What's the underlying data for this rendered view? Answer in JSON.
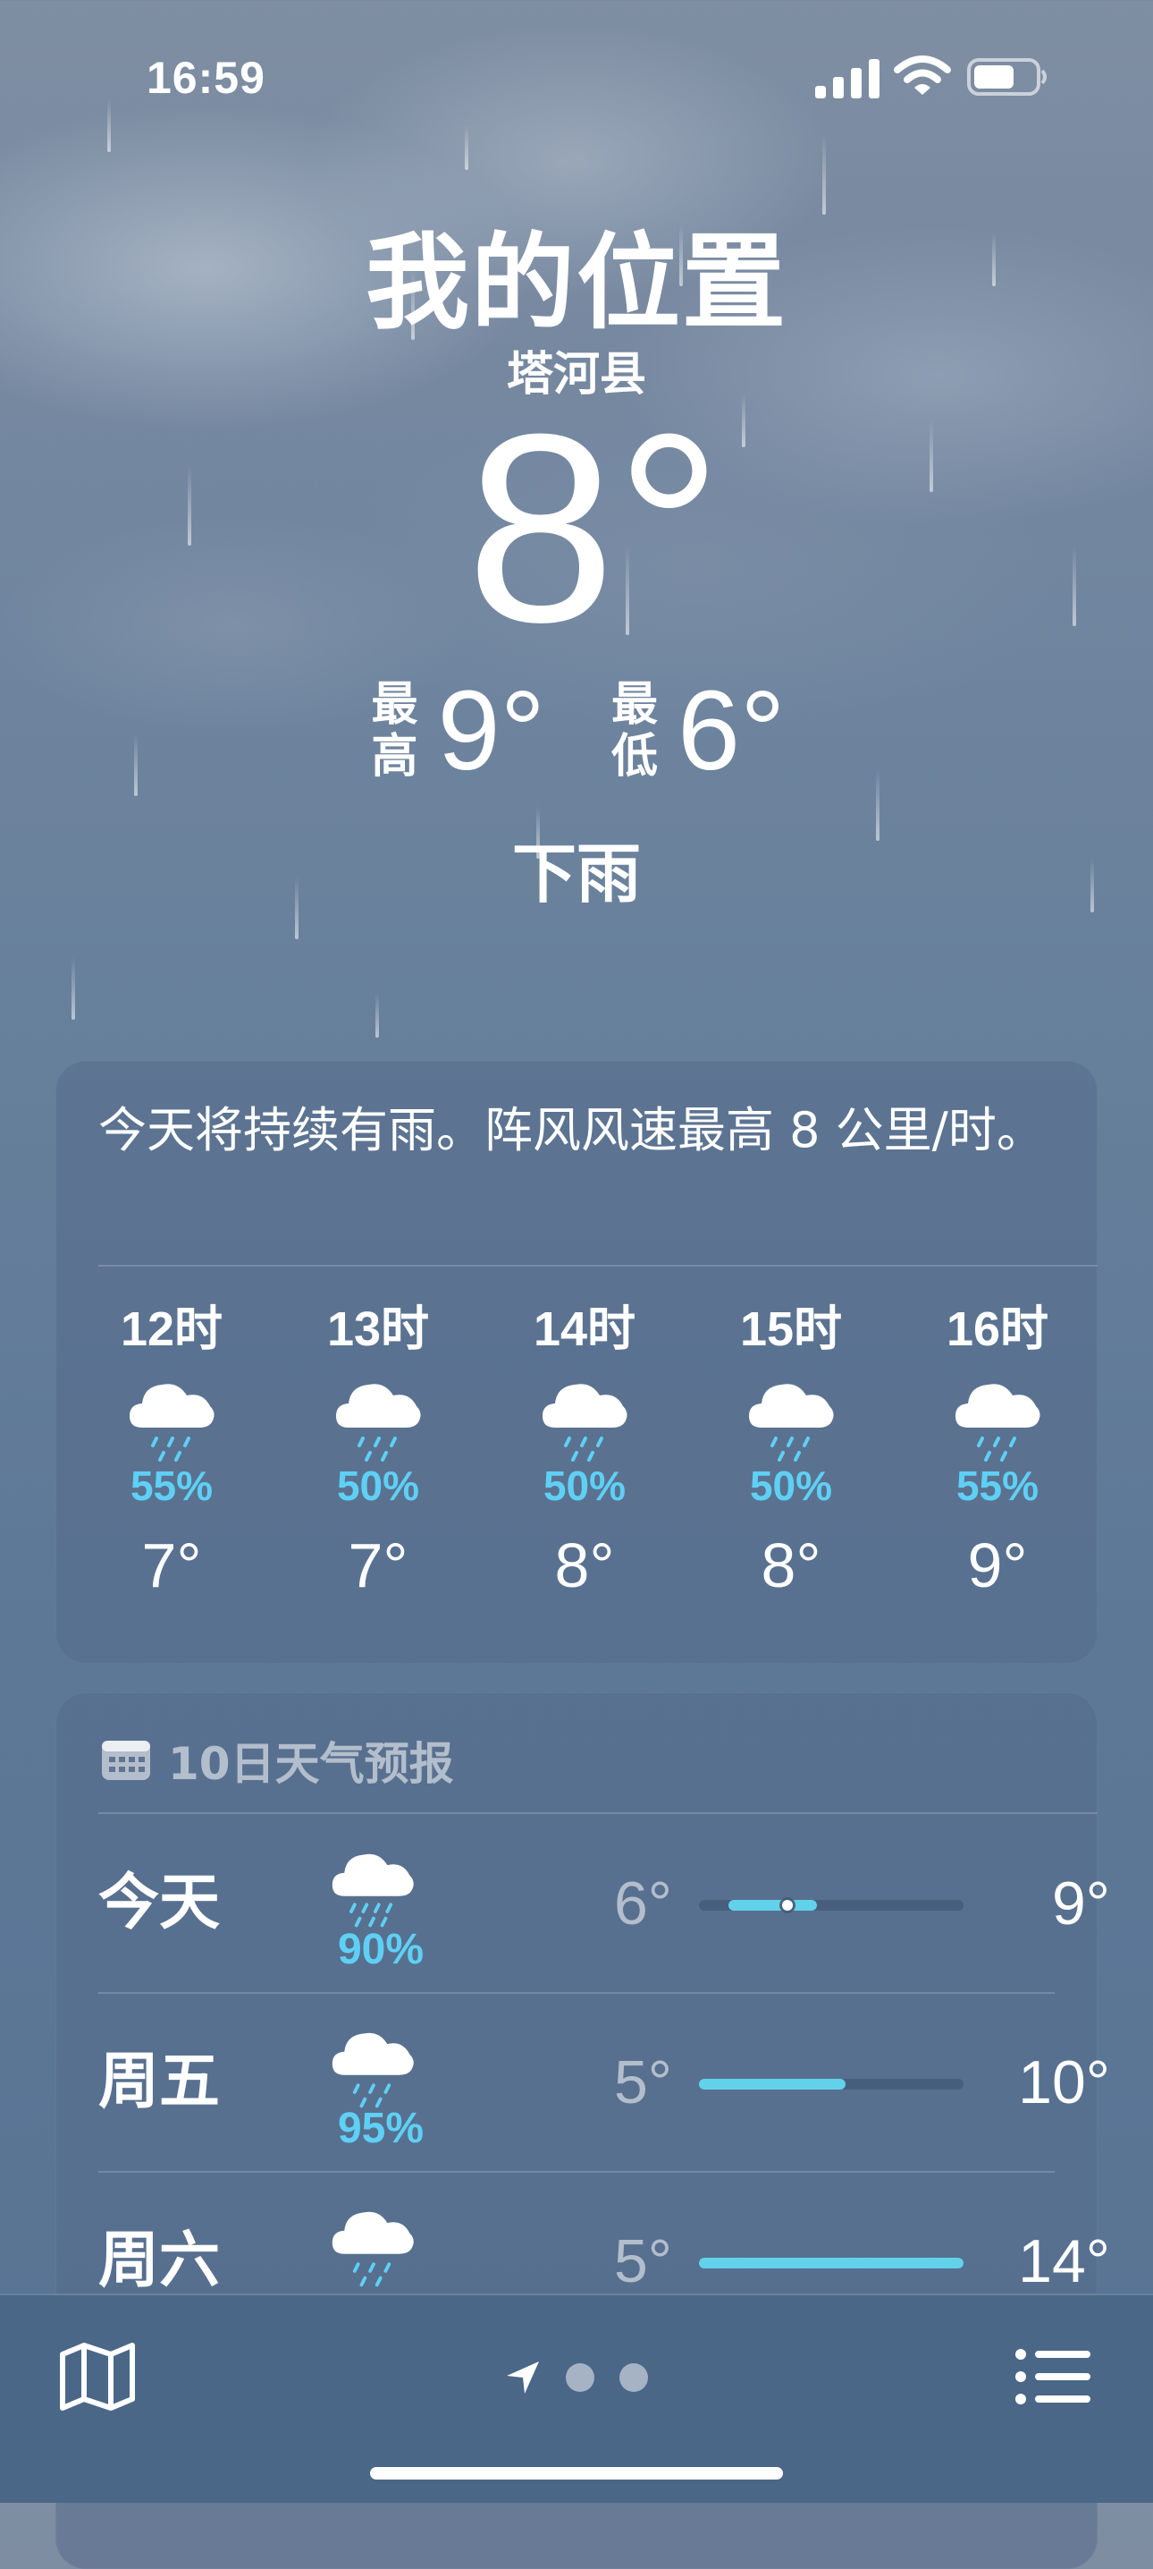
{
  "status_bar": {
    "time": "16:59"
  },
  "header": {
    "title": "我的位置",
    "subtitle": "塔河县",
    "current_temp": "8°",
    "high_label": "最高",
    "high_value": "9°",
    "low_label": "最低",
    "low_value": "6°",
    "condition": "下雨"
  },
  "hourly": {
    "summary": "今天将持续有雨。阵风风速最高 8 公里/时。",
    "items": [
      {
        "hour": "12时",
        "icon": "rain-cloud-icon",
        "pop": "55%",
        "temp": "7°"
      },
      {
        "hour": "13时",
        "icon": "rain-cloud-icon",
        "pop": "50%",
        "temp": "7°"
      },
      {
        "hour": "14时",
        "icon": "rain-cloud-icon",
        "pop": "50%",
        "temp": "8°"
      },
      {
        "hour": "15时",
        "icon": "rain-cloud-icon",
        "pop": "50%",
        "temp": "8°"
      },
      {
        "hour": "16时",
        "icon": "rain-cloud-icon",
        "pop": "55%",
        "temp": "9°"
      }
    ]
  },
  "daily": {
    "header": "10日天气预报",
    "header_icon": "calendar-icon",
    "range_min": 5,
    "range_max": 14,
    "current_temp_value": 8,
    "items": [
      {
        "day": "今天",
        "icon": "heavy-rain-cloud-icon",
        "pop": "90%",
        "low": "6°",
        "high": "9°",
        "low_value": 6,
        "high_value": 9,
        "show_current": true
      },
      {
        "day": "周五",
        "icon": "rain-cloud-icon",
        "pop": "95%",
        "low": "5°",
        "high": "10°",
        "low_value": 5,
        "high_value": 10,
        "show_current": false
      },
      {
        "day": "周六",
        "icon": "rain-cloud-icon",
        "pop": "",
        "low": "5°",
        "high": "14°",
        "low_value": 5,
        "high_value": 14,
        "show_current": false
      }
    ]
  },
  "toolbar": {
    "left_icon": "map-icon",
    "center_icon": "location-arrow-icon",
    "right_icon": "list-icon",
    "page_count": 2
  },
  "colors": {
    "precip": "#5fd0f5",
    "range_fill": "#62d2ea",
    "card_bg": "rgba(86,108,138,0.55)",
    "toolbar_bg": "#4a6788"
  }
}
